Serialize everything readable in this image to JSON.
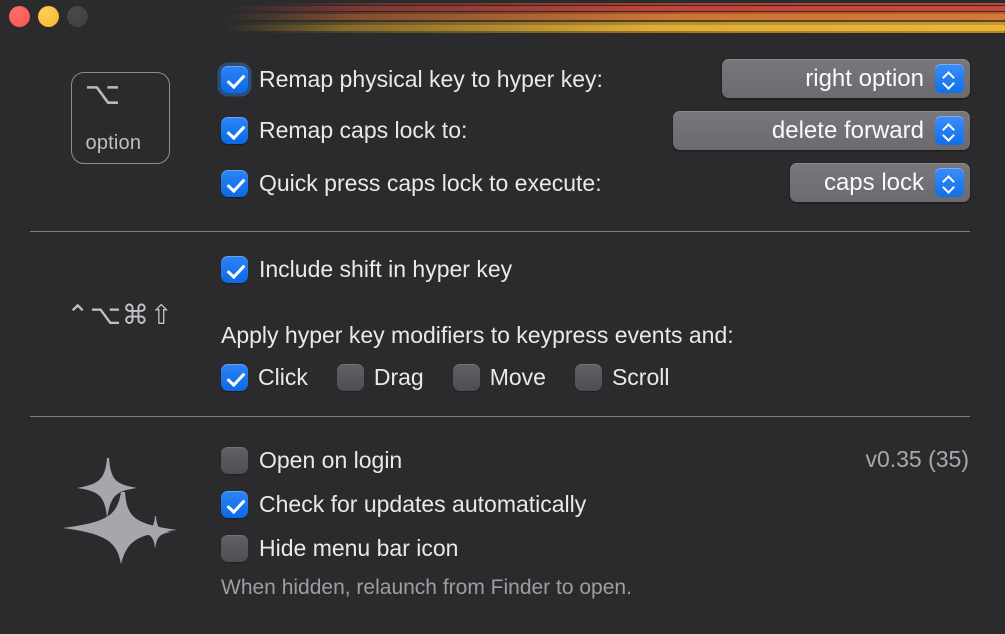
{
  "window": {
    "background_color": "#2b2b2d",
    "traffic_lights": [
      {
        "name": "close",
        "color": "#f9544c",
        "enabled": true
      },
      {
        "name": "minimize",
        "color": "#f8b52a",
        "enabled": true
      },
      {
        "name": "zoom",
        "color": "#3e3e40",
        "enabled": false
      }
    ],
    "accent_color": "#0a6ae4"
  },
  "decoration": {
    "stripe_colors": [
      "#be4836",
      "#c94837",
      "#b75d31",
      "#d3793c",
      "#60451b",
      "#c49a30",
      "#e8b537",
      "#b2892a"
    ]
  },
  "section_keyboard": {
    "icon": {
      "glyph": "⌥",
      "label": "option"
    },
    "rows": [
      {
        "checkbox_label": "Remap physical key to hyper key:",
        "checked": true,
        "focused": true,
        "popup_value": "right option"
      },
      {
        "checkbox_label": "Remap caps lock to:",
        "checked": true,
        "focused": false,
        "popup_value": "delete forward"
      },
      {
        "checkbox_label": "Quick press caps lock to execute:",
        "checked": true,
        "focused": false,
        "popup_value": "caps lock"
      }
    ]
  },
  "section_modifiers": {
    "icon_glyphs": "⌃⌥⌘⇧",
    "include_shift": {
      "label": "Include shift in hyper key",
      "checked": true
    },
    "apply_label": "Apply hyper key modifiers to keypress events and:",
    "event_types": [
      {
        "label": "Click",
        "checked": true
      },
      {
        "label": "Drag",
        "checked": false
      },
      {
        "label": "Move",
        "checked": false
      },
      {
        "label": "Scroll",
        "checked": false
      }
    ]
  },
  "section_app": {
    "icon": "sparkles-icon",
    "version": "v0.35 (35)",
    "rows": [
      {
        "label": "Open on login",
        "checked": false
      },
      {
        "label": "Check for updates automatically",
        "checked": true
      },
      {
        "label": "Hide menu bar icon",
        "checked": false
      }
    ],
    "hint": "When hidden, relaunch from Finder to open."
  }
}
